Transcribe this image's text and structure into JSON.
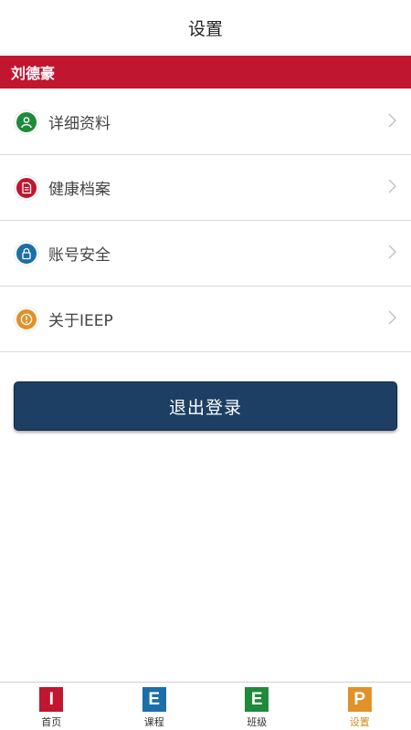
{
  "header": {
    "title": "设置"
  },
  "user": {
    "name": "刘德豪"
  },
  "menu": {
    "items": [
      {
        "label": "详细资料",
        "icon": "person-icon",
        "color": "#1f8a3b"
      },
      {
        "label": "健康档案",
        "icon": "document-icon",
        "color": "#c01630"
      },
      {
        "label": "账号安全",
        "icon": "lock-icon",
        "color": "#1c6fa6"
      },
      {
        "label": "关于IEEP",
        "icon": "info-icon",
        "color": "#e0922a"
      }
    ]
  },
  "logout": {
    "label": "退出登录"
  },
  "tabbar": {
    "tabs": [
      {
        "letter": "I",
        "label": "首页",
        "color": "#c01630"
      },
      {
        "letter": "E",
        "label": "课程",
        "color": "#1c6fa6"
      },
      {
        "letter": "E",
        "label": "班级",
        "color": "#1f8a3b"
      },
      {
        "letter": "P",
        "label": "设置",
        "color": "#e0922a",
        "active": true
      }
    ]
  }
}
